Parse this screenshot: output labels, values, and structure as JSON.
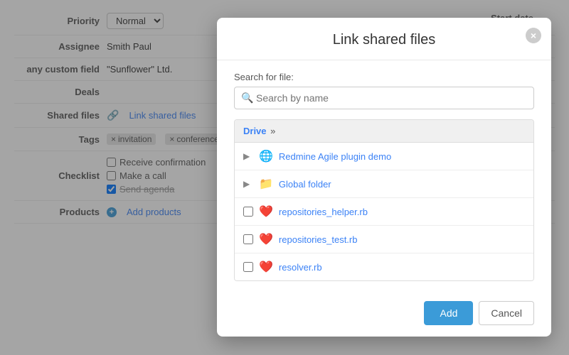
{
  "background": {
    "rows": [
      {
        "label": "Priority",
        "value": "Normal",
        "type": "select"
      },
      {
        "label": "Assignee",
        "value": "Smith Paul",
        "type": "text"
      },
      {
        "label": "any custom field",
        "value": "\"Sunflower\" Ltd.",
        "type": "text"
      },
      {
        "label": "Deals",
        "value": "",
        "type": "empty"
      },
      {
        "label": "Shared files",
        "value": "Link shared files",
        "type": "link"
      },
      {
        "label": "Tags",
        "tags": [
          "invitation",
          "conference"
        ],
        "type": "tags"
      },
      {
        "label": "Checklist",
        "checkboxes": [
          {
            "label": "Receive confirmation",
            "checked": false
          },
          {
            "label": "Make a call",
            "checked": false
          },
          {
            "label": "Send agenda",
            "checked": true,
            "strikethrough": true
          }
        ],
        "type": "checkboxes"
      },
      {
        "label": "Products",
        "value": "Add products",
        "type": "link-add"
      }
    ],
    "start_date_label": "Start date"
  },
  "modal": {
    "title": "Link shared files",
    "close_label": "×",
    "search_label": "Search for file:",
    "search_placeholder": "Search by name",
    "file_list_header": "Drive »",
    "drive_label": "Drive",
    "arrow": "»",
    "files": [
      {
        "id": 1,
        "name": "Redmine Agile plugin demo",
        "icon": "🌐",
        "type": "folder-expandable",
        "color": "#3b82f6"
      },
      {
        "id": 2,
        "name": "Global folder",
        "icon": "📁",
        "type": "folder-expandable",
        "color": "#3b82f6"
      },
      {
        "id": 3,
        "name": "repositories_helper.rb",
        "icon": "❤️",
        "type": "file-checkable",
        "color": "#3b82f6"
      },
      {
        "id": 4,
        "name": "repositories_test.rb",
        "icon": "❤️",
        "type": "file-checkable",
        "color": "#3b82f6"
      },
      {
        "id": 5,
        "name": "resolver.rb",
        "icon": "❤️",
        "type": "file-checkable",
        "color": "#3b82f6"
      }
    ],
    "add_button": "Add",
    "cancel_button": "Cancel"
  }
}
